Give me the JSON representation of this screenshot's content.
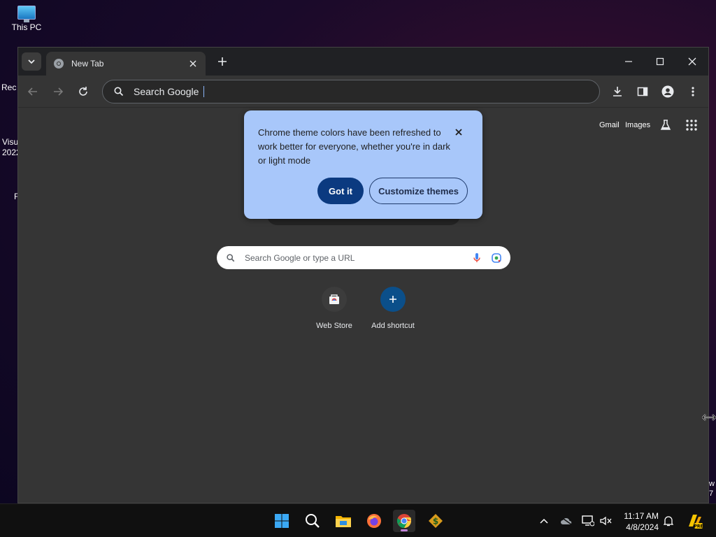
{
  "desktop": {
    "icons": [
      {
        "label": "This PC"
      },
      {
        "label": "Rec"
      },
      {
        "label": "Visu"
      },
      {
        "label": "2022"
      },
      {
        "label": "F"
      }
    ],
    "edge_text": [
      "w",
      "7"
    ]
  },
  "browser": {
    "tab": {
      "title": "New Tab"
    },
    "omnibox": {
      "text": "Search Google"
    },
    "ntp": {
      "header_links": [
        "Gmail",
        "Images"
      ],
      "search_placeholder": "Search Google or type a URL",
      "shortcuts": [
        {
          "label": "Web Store"
        },
        {
          "label": "Add shortcut"
        }
      ]
    },
    "bubble": {
      "message": "Chrome theme colors have been refreshed to work better for everyone, whether you're in dark or light mode",
      "primary_button": "Got it",
      "secondary_button": "Customize themes"
    }
  },
  "taskbar": {
    "apps": [
      "start-icon",
      "search-icon",
      "file-explorer-icon",
      "firefox-icon",
      "chrome-icon",
      "money-app-icon"
    ],
    "clock": {
      "time": "11:17 AM",
      "date": "4/8/2024"
    }
  },
  "colors": {
    "bubble_bg": "#a8c7fa",
    "primary_button_bg": "#0b3a80",
    "window_bg": "#353535"
  }
}
